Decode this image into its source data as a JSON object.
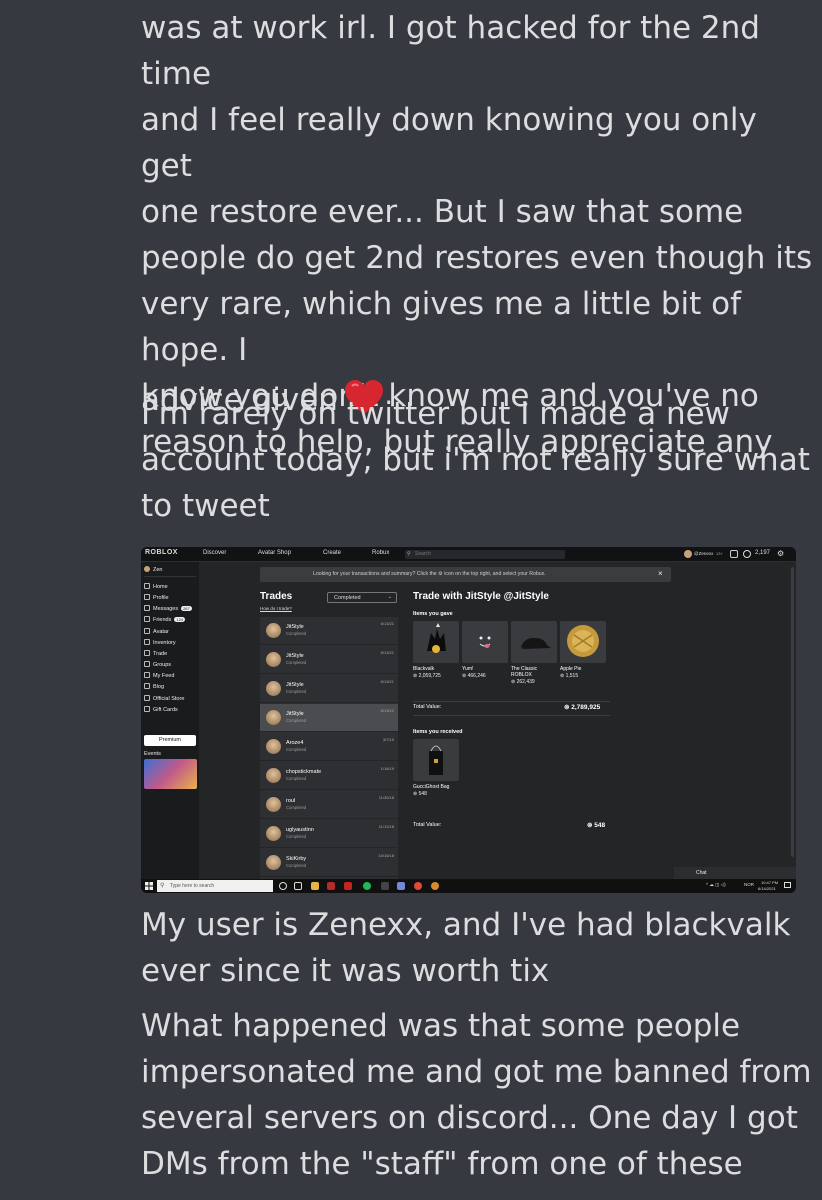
{
  "messages": [
    {
      "text": "was at work irl. I got hacked for the 2nd time\nand I feel really down knowing you only get\none restore ever... But I saw that some\npeople do get 2nd restores even though its\nvery rare, which gives me a little bit of hope. I\nknow you don't know me and you've no\nreason to help, but really appreciate any"
    },
    {
      "text": "advice given",
      "emoji": "red-heart"
    },
    {
      "text": "I'm rarely on twitter but I made a new\naccount today, but i'm not really sure what\nto tweet"
    },
    {
      "text": "My user is Zenexx, and I've had blackvalk\never since it was worth tix"
    },
    {
      "text": "What happened was that some people\nimpersonated me and got me banned from\nseveral servers on discord... One day I got\nDMs from the \"staff\" from one of these"
    }
  ],
  "screenshot": {
    "topbar": {
      "logo": "ROBLOX",
      "nav": [
        "Discover",
        "Avatar Shop",
        "Create",
        "Robux"
      ],
      "search_placeholder": "Search",
      "username": "@Zenexx",
      "age": "13+",
      "robux": "2,197"
    },
    "sidebar": {
      "user": "Zen",
      "items": [
        {
          "label": "Home",
          "icon": "home-icon"
        },
        {
          "label": "Profile",
          "icon": "profile-icon"
        },
        {
          "label": "Messages",
          "icon": "messages-icon",
          "badge": "267"
        },
        {
          "label": "Friends",
          "icon": "friends-icon",
          "badge": "124"
        },
        {
          "label": "Avatar",
          "icon": "avatar-icon"
        },
        {
          "label": "Inventory",
          "icon": "inventory-icon"
        },
        {
          "label": "Trade",
          "icon": "trade-icon"
        },
        {
          "label": "Groups",
          "icon": "groups-icon"
        },
        {
          "label": "My Feed",
          "icon": "feed-icon"
        },
        {
          "label": "Blog",
          "icon": "blog-icon"
        },
        {
          "label": "Official Store",
          "icon": "store-icon"
        },
        {
          "label": "Gift Cards",
          "icon": "giftcard-icon"
        }
      ],
      "premium": "Premium",
      "events": "Events"
    },
    "notice": "Looking for your transactions and summary? Click the ⚙ icon on the top right, and select your Robux.",
    "trades": {
      "title": "Trades",
      "how": "How do I trade?",
      "filter": "Completed",
      "rows": [
        {
          "name": "JitStyle",
          "status": "Completed",
          "date": "6/13/21"
        },
        {
          "name": "JitStyle",
          "status": "Completed",
          "date": "6/13/21"
        },
        {
          "name": "JitStyle",
          "status": "Completed",
          "date": "6/13/21"
        },
        {
          "name": "JitStyle",
          "status": "Completed",
          "date": "6/13/21"
        },
        {
          "name": "Aroze4",
          "status": "Completed",
          "date": "3/7/19"
        },
        {
          "name": "chopstickmate",
          "status": "Completed",
          "date": "1/16/19"
        },
        {
          "name": "roul",
          "status": "Completed",
          "date": "11/30/18"
        },
        {
          "name": "uglyaustinn",
          "status": "Completed",
          "date": "11/12/18"
        },
        {
          "name": "SkiKirby",
          "status": "Completed",
          "date": "10/16/18"
        }
      ]
    },
    "detail": {
      "title": "Trade with JitStyle @JitStyle",
      "gave_label": "Items you gave",
      "gave": [
        {
          "name": "Blackvalk",
          "price": "2,059,725"
        },
        {
          "name": "Yum!",
          "price": "466,246"
        },
        {
          "name": "The Classic ROBLOX",
          "price": "262,439"
        },
        {
          "name": "Apple Pie",
          "price": "1,515"
        }
      ],
      "gave_total_label": "Total Value:",
      "gave_total": "2,789,925",
      "recv_label": "Items you received",
      "received": [
        {
          "name": "GucciGhost Bag",
          "price": "548"
        }
      ],
      "recv_total_label": "Total Value:",
      "recv_total": "548"
    },
    "chat": "Chat",
    "taskbar": {
      "search": "Type here to search",
      "lang": "NOR",
      "time": "10:47 PM",
      "date": "6/14/2021"
    }
  }
}
